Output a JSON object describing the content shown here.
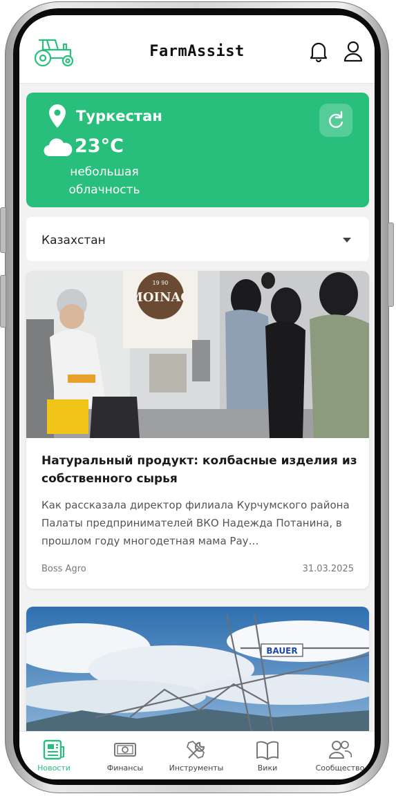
{
  "header": {
    "app_title": "FarmAssist"
  },
  "weather": {
    "city": "Туркестан",
    "temperature": "23°C",
    "condition_line1": "небольшая",
    "condition_line2": "облачность",
    "icon": "cloud-icon"
  },
  "region_select": {
    "selected": "Казахстан"
  },
  "news": [
    {
      "title": "Натуральный продукт: колбасные изделия из собственного сырья",
      "excerpt": "Как рассказала директор филиала Курчумского района Палаты предпринимателей ВКО Надежда Потанина, в прошлом году многодетная мама Рау…",
      "source": "Boss Agro",
      "date": "31.03.2025",
      "image_sign": "MOINAQ",
      "image_sign_year": "19 90"
    },
    {
      "image_sign": "BAUER"
    }
  ],
  "bottom_nav": [
    {
      "label": "Новости",
      "icon": "news-icon",
      "active": true
    },
    {
      "label": "Финансы",
      "icon": "finance-icon",
      "active": false
    },
    {
      "label": "Инструменты",
      "icon": "tools-icon",
      "active": false
    },
    {
      "label": "Вики",
      "icon": "book-icon",
      "active": false
    },
    {
      "label": "Сообщество",
      "icon": "community-icon",
      "active": false
    }
  ],
  "colors": {
    "accent": "#27bf7b",
    "accent_dark": "#1f9e64",
    "screen_bg": "#f2f2f2"
  }
}
